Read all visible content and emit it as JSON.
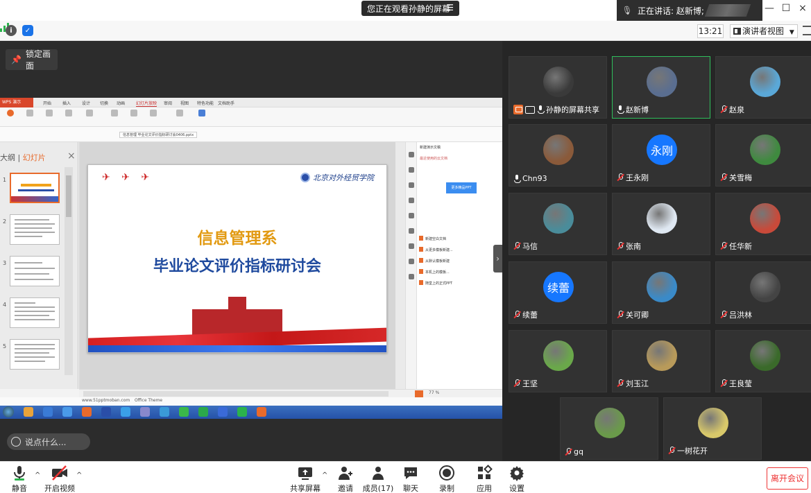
{
  "titlebar": {
    "viewing_banner": "您正在观看孙静的屏幕",
    "speaking_label": "正在讲话: 赵新博;"
  },
  "toolbar": {
    "clock": "13:21",
    "view_mode": "演讲者视图"
  },
  "stage": {
    "lock_label": "锁定画面",
    "comment_placeholder": "说点什么..."
  },
  "shared_screen": {
    "wps_app": "WPS 演示",
    "ribbon_tabs": [
      "开始",
      "插入",
      "设计",
      "切换",
      "动画",
      "幻灯片放映",
      "审阅",
      "视图",
      "特色功能",
      "文档助手"
    ],
    "active_tab": "幻灯片放映",
    "file_tab": "信息管理 毕业论文评价指标研讨会0406.pptx",
    "left_panel": {
      "outline": "大纲",
      "slides": "幻灯片"
    },
    "thumb_numbers": [
      "1",
      "2",
      "3",
      "4",
      "5"
    ],
    "slide": {
      "school_name": "北京对外经贸学院",
      "title1": "信息管理系",
      "title2": "毕业论文评价指标研讨会"
    },
    "right_pane": {
      "title": "新建演示文稿",
      "recent": "最近使用的云文档",
      "open_btn": "更多精品PPT",
      "items": [
        "新建空白文档",
        "从更多模板新建...",
        "从默认模板新建",
        "本机上的模板...",
        "随堂上的正式PPT"
      ]
    },
    "footer_url": "www.51pptmoban.com",
    "theme": "Office Theme",
    "zoom": "77 %"
  },
  "participants": [
    {
      "name": "孙静的屏幕共享",
      "mic": "on",
      "sharing": true,
      "avatar_color": "#3a3a3a"
    },
    {
      "name": "赵新博",
      "mic": "on",
      "selected": true,
      "avatar_color": "#5a6e90"
    },
    {
      "name": "赵泉",
      "mic": "off",
      "avatar_color": "#5aa8d8"
    },
    {
      "name": "Chn93",
      "mic": "on",
      "avatar_color": "#8a5a3a"
    },
    {
      "name": "王永刚",
      "mic": "off",
      "avatar_text": "永刚"
    },
    {
      "name": "关雪梅",
      "mic": "off",
      "avatar_color": "#3f8a3f"
    },
    {
      "name": "马信",
      "mic": "off",
      "avatar_color": "#4a8c9a"
    },
    {
      "name": "张南",
      "mic": "off",
      "avatar_color": "#dfe8f2"
    },
    {
      "name": "任华新",
      "mic": "off",
      "avatar_color": "#c84a3a"
    },
    {
      "name": "续蕾",
      "mic": "off",
      "avatar_text": "续蕾"
    },
    {
      "name": "关可卿",
      "mic": "off",
      "avatar_color": "#3a8ac8"
    },
    {
      "name": "吕洪林",
      "mic": "off",
      "avatar_color": "#444444"
    },
    {
      "name": "王坚",
      "mic": "off",
      "avatar_color": "#6aa84a"
    },
    {
      "name": "刘玉江",
      "mic": "off",
      "avatar_color": "#b89a5a"
    },
    {
      "name": "王良莹",
      "mic": "off",
      "avatar_color": "#3a6a2a"
    },
    {
      "name": "gq",
      "mic": "off",
      "avatar_color": "#6a9a4a"
    },
    {
      "name": "一树花开",
      "mic": "off",
      "avatar_color": "#d8c86a"
    }
  ],
  "bottombar": {
    "mute": "静音",
    "video": "开启视频",
    "share": "共享屏幕",
    "invite": "邀请",
    "members": "成员(17)",
    "chat": "聊天",
    "record": "录制",
    "apps": "应用",
    "settings": "设置",
    "leave": "离开会议"
  },
  "colors": {
    "accent_green": "#2fbf5c",
    "leave_red": "#e33333",
    "avatar_blue": "#1677ff"
  }
}
